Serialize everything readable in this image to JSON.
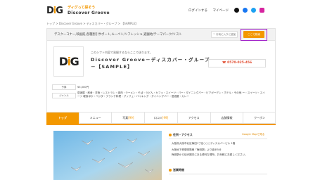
{
  "header": {
    "logo_text": "DiG",
    "tagline_1": "ディグって探そう",
    "tagline_2": "Discover Groove",
    "links": [
      "ログインする",
      "マイページ"
    ],
    "sns": [
      "tiktok-icon",
      "facebook-icon",
      "twitter-icon",
      "instagram-icon"
    ]
  },
  "breadcrumb": "トップ > Discover Groove > ディスカバー・グループ > 【SAMPLE】",
  "topbox": {
    "tags": "デスクーコナー,映画館,各種割引サポート,ルーペト/リフレッシュ,遊園地/テーマパーク/リスト",
    "favorite_label": "♡ お気に入りに追加",
    "select_label": "ここで検索"
  },
  "business": {
    "logo_text": "DiG",
    "catch": "このシフト内容で発掘するならここで送ります。",
    "name": "Discover Groove－ディスカバー・グループ－【SAMPLE】",
    "phone": "☎ 0570-025-456"
  },
  "info": [
    {
      "label": "予算",
      "value": "¥3,000円"
    },
    {
      "label": "ジャンル",
      "value": "居酒屋・和食・洋食・レストラン・焼肉・ラーメン・そば・うどん・カフェ・スイーツ・バー・ダイニングバー・ビアガーデン・ホテル・その他"
    },
    {
      "label": "",
      "value": "ー・スイーツ・スイーツ 軽食ほか・ベジタ・ブランチ料理・ブッフェ・バイキング・ダイニングバー・居酒屋・カレー"
    }
  ],
  "tabs": [
    {
      "label": "トップ",
      "count": ""
    },
    {
      "label": "メニュー",
      "count": ""
    },
    {
      "label": "写真",
      "count": "[99]"
    },
    {
      "label": "口コミ",
      "count": "[99]"
    },
    {
      "label": "アクセス",
      "count": ""
    },
    {
      "label": "店舗情報",
      "count": ""
    },
    {
      "label": "クーポン",
      "count": ""
    }
  ],
  "access": {
    "title": "住所・アクセス",
    "map_link": "Google Mapで見る",
    "lines": [
      "大阪府大阪市北区梅田1丁目○○○ディスカバービル 1階",
      "大阪地下鉄御堂筋線「梅田駅」より徒歩5分",
      "梅田駅から徒歩圏内にある便利な場所、お気軽にお越しください。"
    ]
  },
  "hours": {
    "title": "営業時間"
  },
  "colors": {
    "accent": "#f39800",
    "highlight": "#a020c8"
  }
}
